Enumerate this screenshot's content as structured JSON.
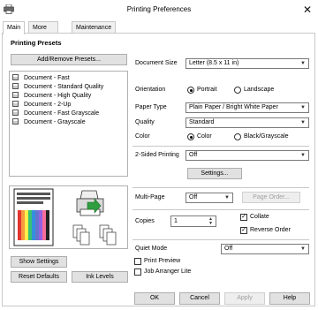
{
  "window": {
    "title": "Printing Preferences",
    "close_glyph": "✕"
  },
  "tabs": [
    {
      "label": "Main"
    },
    {
      "label": "More Options"
    },
    {
      "label": "Maintenance"
    }
  ],
  "presets": {
    "heading": "Printing Presets",
    "add_remove_label": "Add/Remove Presets...",
    "items": [
      "Document - Fast",
      "Document - Standard Quality",
      "Document - High Quality",
      "Document - 2-Up",
      "Document - Fast Grayscale",
      "Document - Grayscale"
    ]
  },
  "left_buttons": {
    "show_settings": "Show Settings",
    "reset_defaults": "Reset Defaults",
    "ink_levels": "Ink Levels"
  },
  "settings": {
    "document_size_label": "Document Size",
    "document_size_value": "Letter (8.5 x 11 in)",
    "orientation_label": "Orientation",
    "orientation_options": [
      "Portrait",
      "Landscape"
    ],
    "orientation_selected": "Portrait",
    "paper_type_label": "Paper Type",
    "paper_type_value": "Plain Paper / Bright White Paper",
    "quality_label": "Quality",
    "quality_value": "Standard",
    "color_label": "Color",
    "color_options": [
      "Color",
      "Black/Grayscale"
    ],
    "color_selected": "Color",
    "two_sided_label": "2-Sided Printing",
    "two_sided_value": "Off",
    "two_sided_settings_label": "Settings...",
    "multi_page_label": "Multi-Page",
    "multi_page_value": "Off",
    "page_order_label": "Page Order...",
    "copies_label": "Copies",
    "copies_value": "1",
    "collate_label": "Collate",
    "collate_checked": true,
    "reverse_order_label": "Reverse Order",
    "reverse_order_checked": true,
    "quiet_mode_label": "Quiet Mode",
    "quiet_mode_value": "Off",
    "print_preview_label": "Print Preview",
    "print_preview_checked": false,
    "job_arranger_label": "Job Arranger Lite",
    "job_arranger_checked": false
  },
  "footer": {
    "ok": "OK",
    "cancel": "Cancel",
    "apply": "Apply",
    "help": "Help"
  },
  "icons": {
    "printer": "printer-icon",
    "dropdown": "chevron-down-icon",
    "spinner": "spinner-arrows-icon"
  },
  "colors": {
    "button_face": "#e1e1e1",
    "border": "#adadad",
    "disabled_text": "#a0a0a0"
  }
}
